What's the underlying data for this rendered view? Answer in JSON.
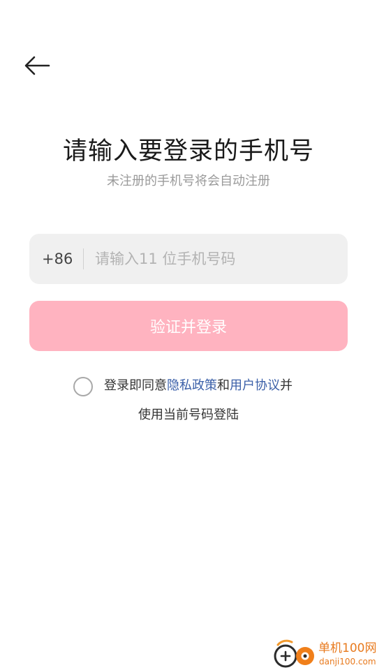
{
  "header": {
    "back_icon": "arrow-left-icon"
  },
  "main": {
    "title": "请输入要登录的手机号",
    "subtitle": "未注册的手机号将会自动注册",
    "phone": {
      "country_code": "+86",
      "placeholder": "请输入11 位手机号码",
      "value": ""
    },
    "login_button_label": "验证并登录",
    "agreement": {
      "checked": false,
      "prefix": "登录即同意",
      "privacy_link": "隐私政策",
      "and": "和",
      "user_agreement_link": "用户协议",
      "suffix": "并",
      "line2": "使用当前号码登陆"
    }
  },
  "watermark": {
    "name": "单机100网",
    "url": "danji100.com"
  },
  "colors": {
    "button_bg": "#ffb3c0",
    "link": "#3a5fa8",
    "input_bg": "#f0f0f0",
    "watermark": "#e87a1e"
  }
}
